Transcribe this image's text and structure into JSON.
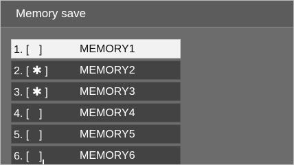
{
  "title": "Memory save",
  "selected_index": 0,
  "memories": [
    {
      "number": "1.",
      "slot": " ",
      "name": "MEMORY1"
    },
    {
      "number": "2.",
      "slot": "✱",
      "name": "MEMORY2"
    },
    {
      "number": "3.",
      "slot": "✱",
      "name": "MEMORY3"
    },
    {
      "number": "4.",
      "slot": " ",
      "name": "MEMORY4"
    },
    {
      "number": "5.",
      "slot": " ",
      "name": "MEMORY5"
    },
    {
      "number": "6.",
      "slot": " ",
      "name": "MEMORY6"
    }
  ]
}
